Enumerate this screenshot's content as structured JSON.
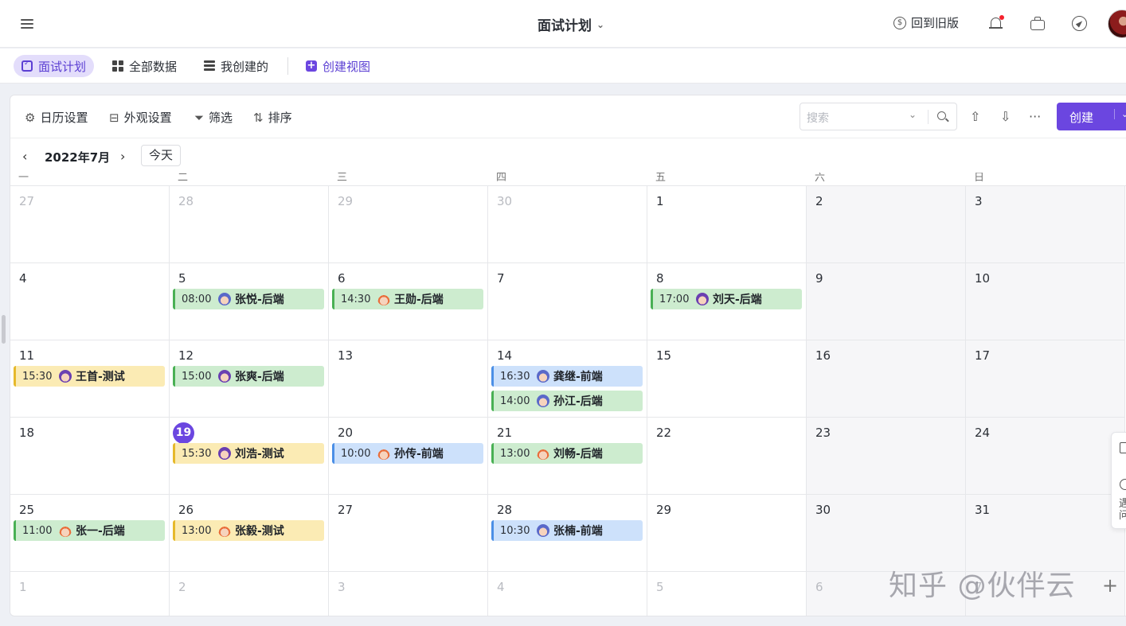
{
  "header": {
    "title": "面试计划",
    "back_old": "回到旧版"
  },
  "views": {
    "tabs": [
      "面试计划",
      "全部数据",
      "我创建的"
    ],
    "create_view": "创建视图"
  },
  "toolbar": {
    "calendar_settings": "日历设置",
    "appearance_settings": "外观设置",
    "filter": "筛选",
    "sort": "排序",
    "search_placeholder": "搜索",
    "create": "创建"
  },
  "nav": {
    "month": "2022年7月",
    "today": "今天"
  },
  "weekdays": [
    "一",
    "二",
    "三",
    "四",
    "五",
    "六",
    "日"
  ],
  "weeks": [
    [
      {
        "day": "27",
        "dim": true,
        "events": []
      },
      {
        "day": "28",
        "dim": true,
        "events": []
      },
      {
        "day": "29",
        "dim": true,
        "events": []
      },
      {
        "day": "30",
        "dim": true,
        "events": []
      },
      {
        "day": "1",
        "events": []
      },
      {
        "day": "2",
        "events": []
      },
      {
        "day": "3",
        "events": []
      }
    ],
    [
      {
        "day": "4",
        "events": []
      },
      {
        "day": "5",
        "events": [
          {
            "time": "08:00",
            "name": "张悦-后端",
            "color": "green",
            "avatar": "p"
          }
        ]
      },
      {
        "day": "6",
        "events": [
          {
            "time": "14:30",
            "name": "王勋-后端",
            "color": "green",
            "avatar": "m"
          }
        ]
      },
      {
        "day": "7",
        "events": []
      },
      {
        "day": "8",
        "events": [
          {
            "time": "17:00",
            "name": "刘天-后端",
            "color": "green",
            "avatar": "f"
          }
        ]
      },
      {
        "day": "9",
        "events": []
      },
      {
        "day": "10",
        "events": []
      }
    ],
    [
      {
        "day": "11",
        "events": [
          {
            "time": "15:30",
            "name": "王首-测试",
            "color": "yellow",
            "avatar": "f"
          }
        ]
      },
      {
        "day": "12",
        "events": [
          {
            "time": "15:00",
            "name": "张爽-后端",
            "color": "green",
            "avatar": "f"
          }
        ]
      },
      {
        "day": "13",
        "events": []
      },
      {
        "day": "14",
        "events": [
          {
            "time": "16:30",
            "name": "龚继-前端",
            "color": "blue",
            "avatar": "p"
          },
          {
            "time": "14:00",
            "name": "孙江-后端",
            "color": "green",
            "avatar": "p"
          }
        ]
      },
      {
        "day": "15",
        "events": []
      },
      {
        "day": "16",
        "events": []
      },
      {
        "day": "17",
        "events": []
      }
    ],
    [
      {
        "day": "18",
        "events": []
      },
      {
        "day": "19",
        "today": true,
        "events": [
          {
            "time": "15:30",
            "name": "刘浩-测试",
            "color": "yellow",
            "avatar": "f"
          }
        ]
      },
      {
        "day": "20",
        "events": [
          {
            "time": "10:00",
            "name": "孙传-前端",
            "color": "blue",
            "avatar": "m"
          }
        ]
      },
      {
        "day": "21",
        "events": [
          {
            "time": "13:00",
            "name": "刘畅-后端",
            "color": "green",
            "avatar": "m"
          }
        ]
      },
      {
        "day": "22",
        "events": []
      },
      {
        "day": "23",
        "events": []
      },
      {
        "day": "24",
        "events": []
      }
    ],
    [
      {
        "day": "25",
        "events": [
          {
            "time": "11:00",
            "name": "张一-后端",
            "color": "green",
            "avatar": "m"
          }
        ]
      },
      {
        "day": "26",
        "events": [
          {
            "time": "13:00",
            "name": "张毅-测试",
            "color": "yellow",
            "avatar": "m"
          }
        ]
      },
      {
        "day": "27",
        "events": []
      },
      {
        "day": "28",
        "events": [
          {
            "time": "10:30",
            "name": "张楠-前端",
            "color": "blue",
            "avatar": "p"
          }
        ]
      },
      {
        "day": "29",
        "events": []
      },
      {
        "day": "30",
        "events": []
      },
      {
        "day": "31",
        "events": []
      }
    ],
    [
      {
        "day": "1",
        "dim": true,
        "events": []
      },
      {
        "day": "2",
        "dim": true,
        "events": []
      },
      {
        "day": "3",
        "dim": true,
        "events": []
      },
      {
        "day": "4",
        "dim": true,
        "events": []
      },
      {
        "day": "5",
        "dim": true,
        "events": []
      },
      {
        "day": "6",
        "dim": true,
        "events": []
      },
      {
        "day": "7",
        "dim": true,
        "events": []
      }
    ]
  ],
  "side_widget_text": "遇问",
  "watermark": "知乎 @伙伴云",
  "colors": {
    "accent": "#6b46e0",
    "event_green": "#cdeccf",
    "event_yellow": "#fbebb4",
    "event_blue": "#cde1fb"
  }
}
